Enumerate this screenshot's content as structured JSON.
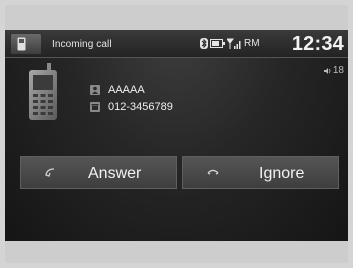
{
  "header": {
    "title": "Incoming call",
    "network": "RM",
    "clock": "12:34",
    "icons": [
      "phone-icon",
      "bluetooth-icon",
      "battery-icon",
      "signal-icon"
    ]
  },
  "volume": {
    "level": "18",
    "icon": "speaker-icon"
  },
  "caller": {
    "name": "AAAAA",
    "number": "012-3456789",
    "name_icon": "contact-icon",
    "number_icon": "phone-number-icon"
  },
  "actions": {
    "answer_label": "Answer",
    "ignore_label": "Ignore",
    "answer_icon": "phone-pickup-icon",
    "ignore_icon": "phone-hangup-icon"
  },
  "colors": {
    "screen_bg": "#1e1e1e",
    "button_bg": "#4a4a4a",
    "text": "#f2f2f2",
    "frame": "#cdcdcd"
  }
}
